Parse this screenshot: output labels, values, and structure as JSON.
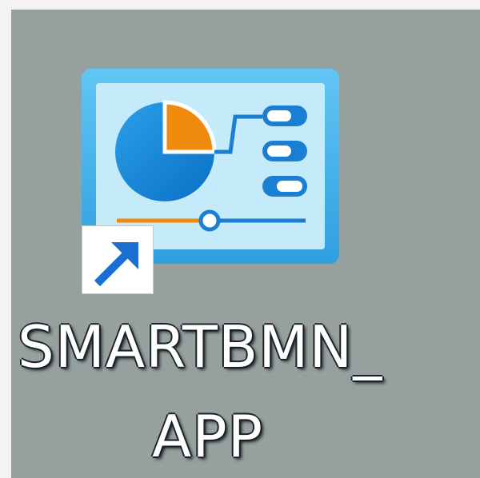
{
  "desktop_icon": {
    "label_line1": "SMARTBMN_",
    "label_line2": "APP",
    "icon": "dashboard-app-icon",
    "overlay": "shortcut-arrow-icon"
  },
  "colors": {
    "tile_background": "#96a19f",
    "outer_background": "#f3f3f3",
    "icon_frame": "#4ab5ea",
    "icon_screen": "#c5ebfb",
    "pie_blue": "#1a8cda",
    "pie_orange": "#f08a0c",
    "arrow_blue": "#1a6fd0"
  }
}
